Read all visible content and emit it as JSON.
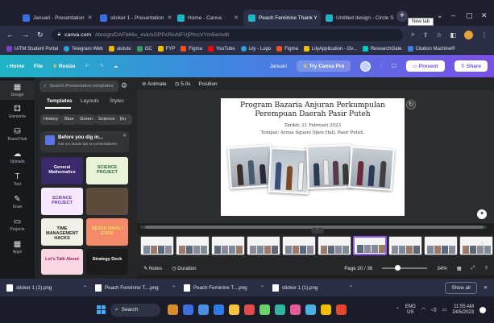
{
  "browser": {
    "tabs": [
      {
        "title": "Januari - Presentation",
        "color": "#3b6fe0",
        "active": false
      },
      {
        "title": "sticker 1 - Presentation",
        "color": "#3b6fe0",
        "active": false
      },
      {
        "title": "Home - Canva",
        "color": "#1fb5c5",
        "active": false
      },
      {
        "title": "Peach Feminine Thank Y",
        "color": "#1fb5c5",
        "active": true
      },
      {
        "title": "Untitled design - Circle S",
        "color": "#1fb5c5",
        "active": false
      }
    ],
    "new_tab_tooltip": "New tab",
    "url_host": "canva.com",
    "url_path": "/design/DAFb66u_evk/uGPPcRiuNFUjPhrcVYm5w/edit",
    "bookmarks": [
      "UiTM Student Portal",
      "Telegram Web",
      "uiutute",
      "GC",
      "FYP",
      "Figma",
      "YouTube",
      "Lily - Logo",
      "Figma",
      "LilyApplication - Ov...",
      "ResearchGate",
      "Citation Machine®"
    ]
  },
  "canva": {
    "topbar": {
      "home": "Home",
      "file": "File",
      "resize": "Resize",
      "title": "Januari",
      "try_pro": "Try Canva Pro",
      "present": "Present",
      "share": "Share"
    },
    "rail": [
      {
        "label": "Design",
        "icon": "▦"
      },
      {
        "label": "Elements",
        "icon": "⚃"
      },
      {
        "label": "Brand Hub",
        "icon": "⛁"
      },
      {
        "label": "Uploads",
        "icon": "☁"
      },
      {
        "label": "Text",
        "icon": "T"
      },
      {
        "label": "Draw",
        "icon": "✎"
      },
      {
        "label": "Projects",
        "icon": "▭"
      },
      {
        "label": "Apps",
        "icon": "▦"
      }
    ],
    "panel": {
      "search_placeholder": "Search Presentation templates",
      "tabs": [
        "Templates",
        "Layouts",
        "Styles"
      ],
      "chips": [
        "History",
        "Blue",
        "Green",
        "Science",
        "Bu"
      ],
      "tip_title": "Before you dig in...",
      "tip_sub": "Get our hands tips on presentations.",
      "thumbnails": [
        {
          "text": "General Mathematics",
          "bg": "#3a2a6a",
          "fg": "#ffffff"
        },
        {
          "text": "SCIENCE PROJECT",
          "bg": "#e9f3d8",
          "fg": "#2f6b3a"
        },
        {
          "text": "SCIENCE PROJECT",
          "bg": "#f6e9ff",
          "fg": "#6a3ab0"
        },
        {
          "text": "",
          "bg": "#5c4a3a",
          "fg": "#ffffff"
        },
        {
          "text": "TIME MANAGEMENT HACKS",
          "bg": "#f2efe6",
          "fg": "#222222"
        },
        {
          "text": "NEVER HAVE I EVER",
          "bg": "#f58a6a",
          "fg": "#ffe15a"
        },
        {
          "text": "Let's Talk About",
          "bg": "#f9d7e3",
          "fg": "#a0225a"
        },
        {
          "text": "Strategy Deck",
          "bg": "#1b1b1b",
          "fg": "#ffffff"
        }
      ]
    },
    "editor": {
      "animate": "Animate",
      "duration": "5.0s",
      "position": "Position"
    },
    "slide": {
      "title": "Program Bazaria Anjuran Perkumpulan Perempuan Daerah Pasir Puteh",
      "date": "Tarikh: 21 Februari 2023",
      "venue": "Tempat: Arena Square 0pen Hall, Pasir Puteh."
    },
    "footer": {
      "notes": "Notes",
      "duration": "Duration",
      "page": "Page 20 / 36",
      "zoom": "34%",
      "zoom_fraction": 0.34
    }
  },
  "downloads": {
    "items": [
      "sticker 1 (2).png",
      "Peach Feminine T....png",
      "Peach Feminine T....png",
      "sticker 1 (1).png"
    ],
    "show_all": "Show all"
  },
  "taskbar": {
    "search": "Search",
    "apps": [
      "#d98a2b",
      "#3b6fe0",
      "#4a90e2",
      "#2d7be5",
      "#f5c242",
      "#e24a4a",
      "#6bcf6b",
      "#2fb5a0",
      "#e65a9a",
      "#4ab0e2",
      "#f0c000",
      "#e8452f"
    ],
    "lang": "ENG",
    "region": "US",
    "time": "11:55 AM",
    "date": "24/5/2023"
  }
}
